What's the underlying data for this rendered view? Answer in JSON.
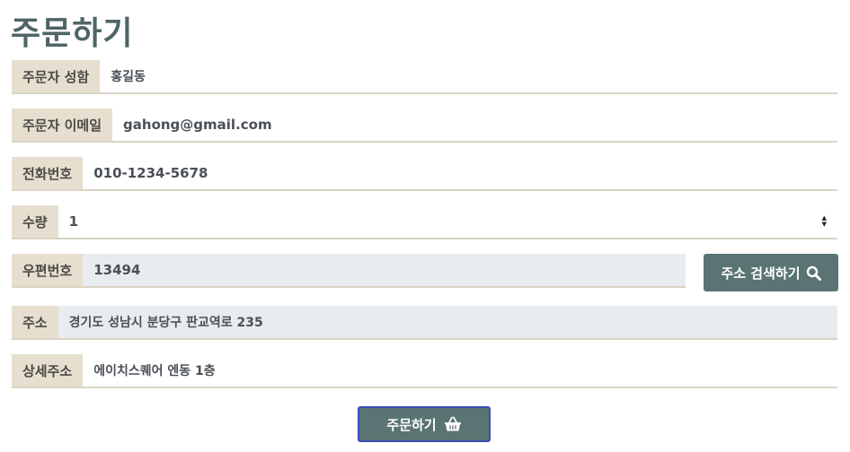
{
  "page": {
    "title": "주문하기"
  },
  "form": {
    "name": {
      "label": "주문자 성함",
      "value": "홍길동"
    },
    "email": {
      "label": "주문자 이메일",
      "value": "gahong@gmail.com"
    },
    "phone": {
      "label": "전화번호",
      "value": "010-1234-5678"
    },
    "quantity": {
      "label": "수량",
      "value": "1"
    },
    "zipcode": {
      "label": "우편번호",
      "value": "13494"
    },
    "address": {
      "label": "주소",
      "value": "경기도 성남시 분당구 판교역로 235"
    },
    "detail_address": {
      "label": "상세주소",
      "value": "에이치스퀘어 엔동 1층"
    }
  },
  "buttons": {
    "search_address": {
      "label": "주소 검색하기",
      "icon": "search-icon"
    },
    "submit": {
      "label": "주문하기",
      "icon": "basket-icon"
    }
  },
  "colors": {
    "title": "#4f6566",
    "label_bg": "#e6dfcf",
    "readonly_bg": "#e9ecef",
    "button_bg": "#5a7373",
    "submit_border": "#3b4db8"
  }
}
